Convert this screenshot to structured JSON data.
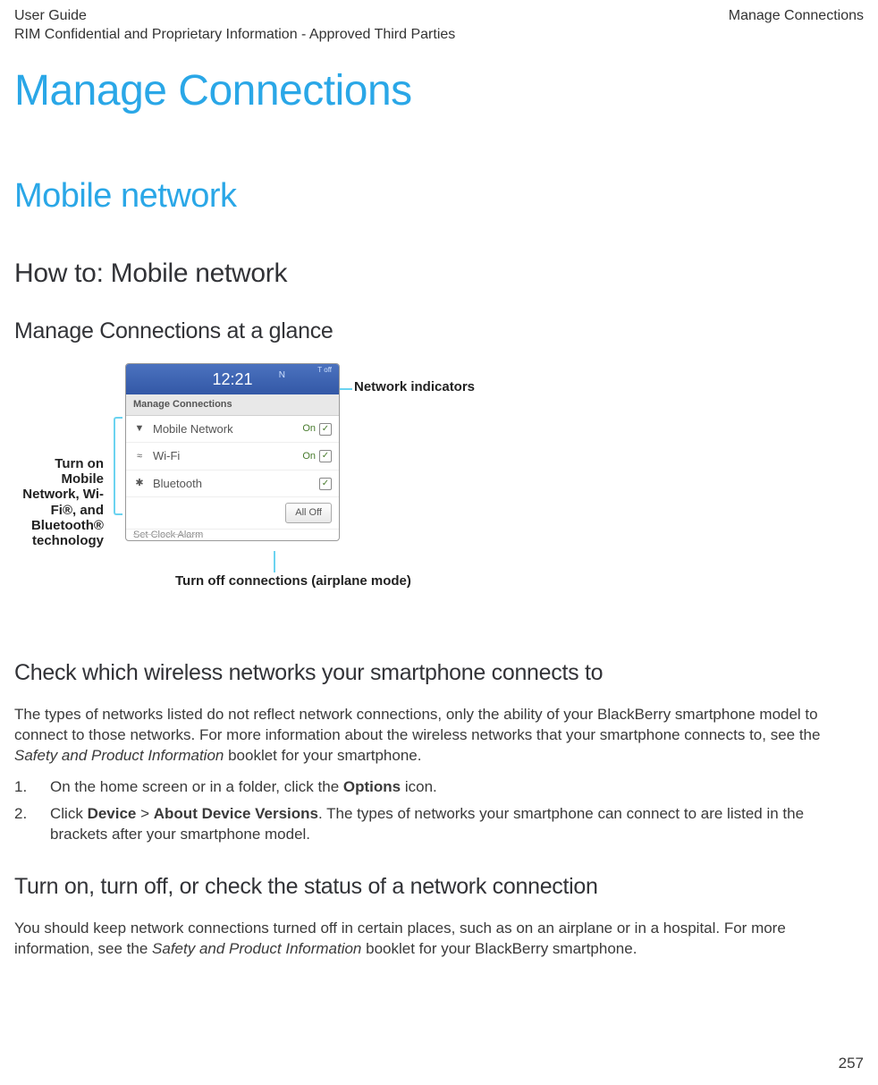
{
  "header": {
    "left_line1": "User Guide",
    "left_line2": "RIM Confidential and Proprietary Information - Approved Third Parties",
    "right": "Manage Connections"
  },
  "title": "Manage Connections",
  "section": "Mobile network",
  "subsection": "How to: Mobile network",
  "topic_glance": "Manage Connections at a glance",
  "diagram": {
    "callout_left": "Turn on Mobile Network, Wi-Fi®, and Bluetooth® technology",
    "callout_right": "Network indicators",
    "callout_bottom": "Turn off connections (airplane mode)",
    "phone": {
      "time": "12:21",
      "n_label": "N",
      "off_tiny": "T off",
      "panel_head": "Manage Connections",
      "rows": [
        {
          "icon": "▼",
          "label": "Mobile Network",
          "status": "On",
          "checked": true
        },
        {
          "icon": "≈",
          "label": "Wi-Fi",
          "status": "On",
          "checked": true
        },
        {
          "icon": "✱",
          "label": "Bluetooth",
          "status": "",
          "checked": true
        }
      ],
      "all_off": "All Off",
      "clock_alarm": "Set Clock Alarm"
    }
  },
  "topic_check": {
    "title": "Check which wireless networks your smartphone connects to",
    "para_prefix": "The types of networks listed do not reflect network connections, only the ability of your BlackBerry smartphone model to connect to those networks. For more information about the wireless networks that your smartphone connects to, see the ",
    "para_italic": "Safety and Product Information",
    "para_suffix": " booklet for your smartphone.",
    "step1_prefix": "On the home screen or in a folder, click the ",
    "step1_bold": "Options",
    "step1_suffix": " icon.",
    "step2_prefix": "Click ",
    "step2_bold1": "Device",
    "step2_sep": " > ",
    "step2_bold2": "About Device Versions",
    "step2_suffix": ". The types of networks your smartphone can connect to are listed in the brackets after your smartphone model."
  },
  "topic_turn": {
    "title": "Turn on, turn off, or check the status of a network connection",
    "para_prefix": "You should keep network connections turned off in certain places, such as on an airplane or in a hospital. For more information, see the ",
    "para_italic": "Safety and Product Information",
    "para_suffix": " booklet for your BlackBerry smartphone."
  },
  "page_number": "257"
}
